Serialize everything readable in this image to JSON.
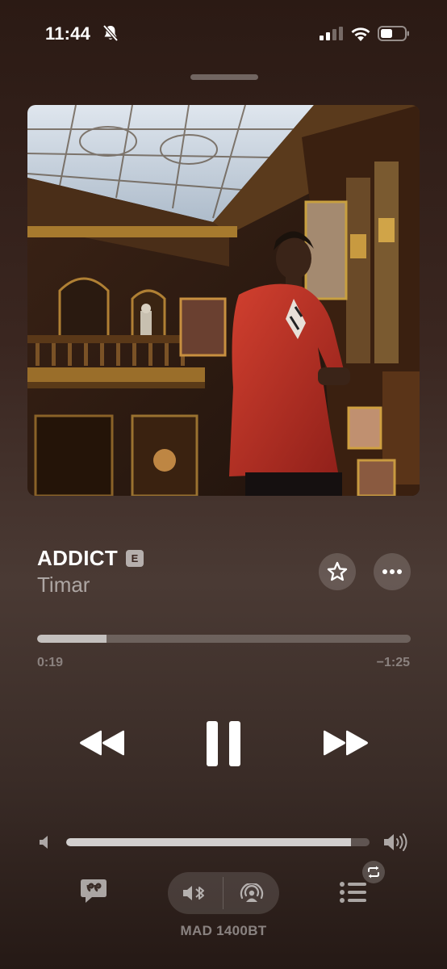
{
  "status_bar": {
    "time": "11:44",
    "icons": [
      "bell-slash-icon",
      "signal-icon",
      "wifi-icon",
      "battery-icon"
    ]
  },
  "now_playing": {
    "title": "ADDICT",
    "explicit_badge": "E",
    "artist": "Timar",
    "artwork_description_icon": "album-artwork",
    "favorite_icon": "star-icon",
    "more_icon": "ellipsis-icon"
  },
  "progress": {
    "elapsed": "0:19",
    "remaining": "−1:25",
    "fraction": 0.185
  },
  "transport": {
    "previous_icon": "rewind-icon",
    "play_pause_icon": "pause-icon",
    "next_icon": "fast-forward-icon"
  },
  "volume": {
    "level": 0.94,
    "low_icon": "speaker-low-icon",
    "high_icon": "speaker-high-icon"
  },
  "bottom_bar": {
    "lyrics_icon": "lyrics-icon",
    "route_icons": [
      "bluetooth-speaker-icon",
      "airplay-icon"
    ],
    "device_name": "MAD 1400BT",
    "queue_icon": "queue-icon",
    "repeat_icon": "repeat-icon"
  },
  "colors": {
    "background_top": "#2b1a14",
    "background_mid": "#4a3a34",
    "jacket_red": "#c2332a"
  }
}
